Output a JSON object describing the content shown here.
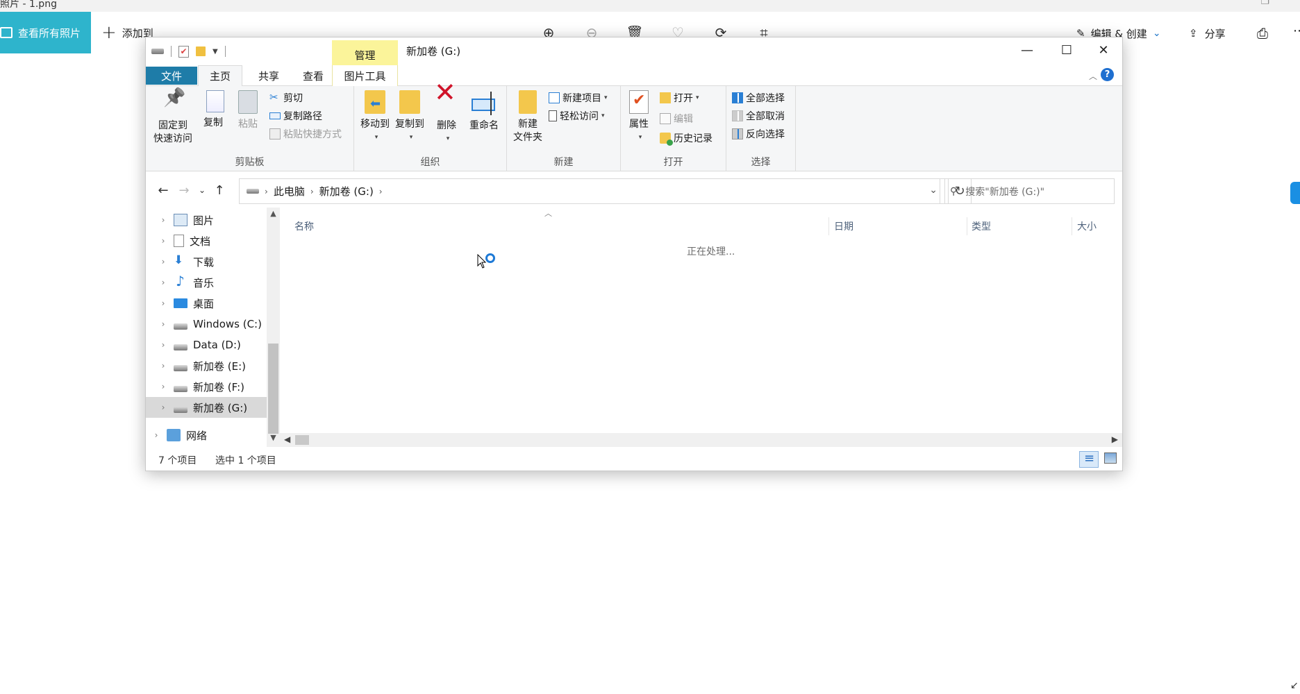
{
  "photos": {
    "title": "照片 - 1.png",
    "view_all": "查看所有照片",
    "add_to": "添加到",
    "edit_create": "编辑 & 创建",
    "share": "分享"
  },
  "explorer": {
    "title": "新加卷 (G:)",
    "tabs": {
      "manage": "管理",
      "file": "文件",
      "home": "主页",
      "share": "共享",
      "view": "查看",
      "picture_tools": "图片工具"
    },
    "ribbon": {
      "clipboard": {
        "label": "剪贴板",
        "pin": "固定到\n快速访问",
        "copy": "复制",
        "paste": "粘贴",
        "cut": "剪切",
        "copy_path": "复制路径",
        "paste_shortcut": "粘贴快捷方式"
      },
      "organize": {
        "label": "组织",
        "move_to": "移动到",
        "copy_to": "复制到",
        "delete": "删除",
        "rename": "重命名"
      },
      "new": {
        "label": "新建",
        "new_folder": "新建\n文件夹",
        "new_item": "新建项目",
        "easy_access": "轻松访问"
      },
      "open": {
        "label": "打开",
        "properties": "属性",
        "open": "打开",
        "edit": "编辑",
        "history": "历史记录"
      },
      "select": {
        "label": "选择",
        "select_all": "全部选择",
        "select_none": "全部取消",
        "invert": "反向选择"
      }
    },
    "address": {
      "crumbs": [
        "此电脑",
        "新加卷 (G:)"
      ],
      "search_placeholder": "搜索\"新加卷 (G:)\""
    },
    "nav_tree": [
      {
        "label": "图片",
        "icon": "pictures-icon"
      },
      {
        "label": "文档",
        "icon": "documents-icon"
      },
      {
        "label": "下载",
        "icon": "downloads-icon"
      },
      {
        "label": "音乐",
        "icon": "music-icon"
      },
      {
        "label": "桌面",
        "icon": "desktop-icon"
      },
      {
        "label": "Windows (C:)",
        "icon": "drive-icon"
      },
      {
        "label": "Data (D:)",
        "icon": "drive-icon"
      },
      {
        "label": "新加卷 (E:)",
        "icon": "drive-icon"
      },
      {
        "label": "新加卷 (F:)",
        "icon": "drive-icon"
      },
      {
        "label": "新加卷 (G:)",
        "icon": "drive-icon",
        "selected": true
      },
      {
        "label": "网络",
        "icon": "network-icon"
      }
    ],
    "columns": {
      "name": "名称",
      "date": "日期",
      "type": "类型",
      "size": "大小"
    },
    "processing": "正在处理...",
    "status": {
      "count": "7 个项目",
      "selected": "选中 1 个项目"
    }
  }
}
